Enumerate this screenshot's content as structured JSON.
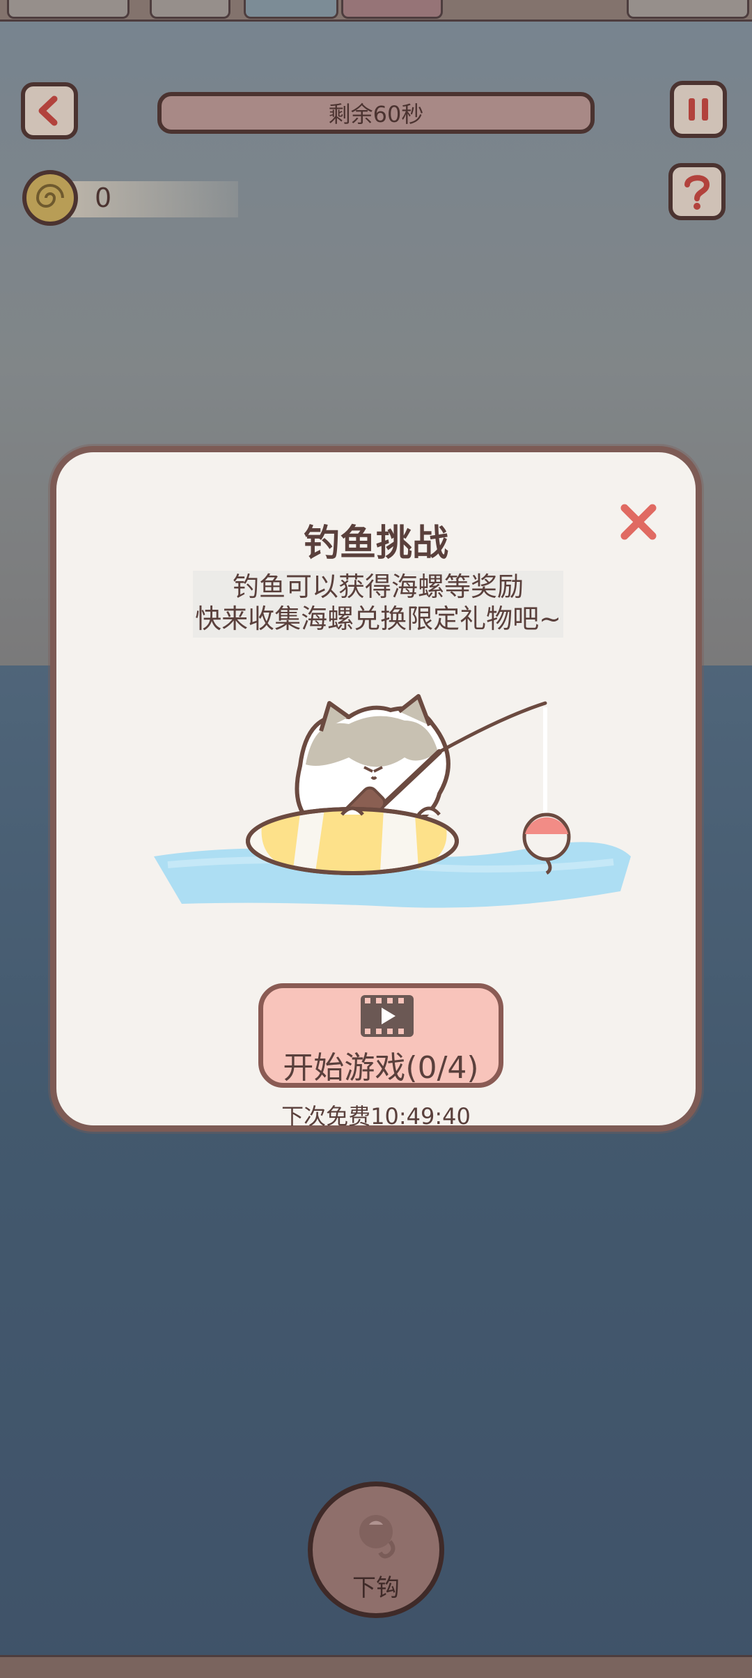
{
  "hud": {
    "back_icon": "chevron-left-icon",
    "timer_text": "剩余60秒",
    "pause_icon": "pause-icon",
    "help_icon": "question-icon",
    "shell_count": "0"
  },
  "modal": {
    "title": "钓鱼挑战",
    "description_line1": "钓鱼可以获得海螺等奖励",
    "description_line2": "快来收集海螺兑换限定礼物吧~",
    "close_icon": "close-icon",
    "start_button_label": "开始游戏(0/4)",
    "start_button_icon": "video-icon",
    "next_free_text": "下次免费10:49:40"
  },
  "bottom": {
    "hook_button_label": "下钩",
    "hook_icon": "fishing-hook-icon"
  },
  "colors": {
    "modal_bg": "#f5f2ee",
    "modal_border": "#7d5b55",
    "close_x": "#e06a62",
    "start_button_bg": "#f8c4bb",
    "water": "#a9dcf2",
    "float_top": "#f28c86"
  }
}
